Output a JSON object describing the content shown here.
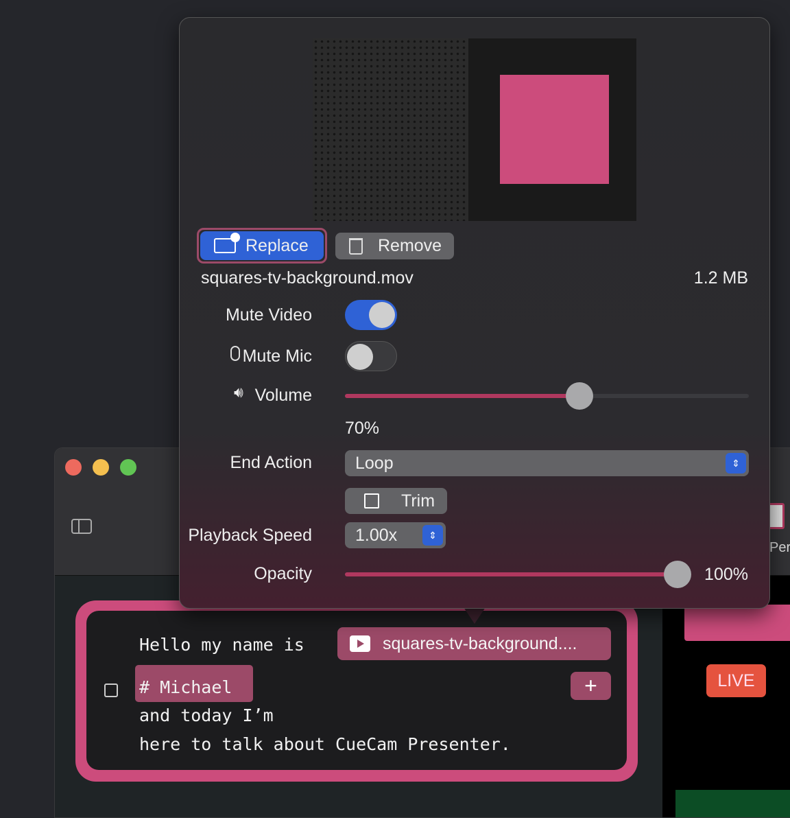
{
  "media": {
    "replace_label": "Replace",
    "remove_label": "Remove",
    "filename": "squares-tv-background.mov",
    "filesize": "1.2 MB"
  },
  "settings": {
    "mute_video_label": "Mute Video",
    "mute_video_on": true,
    "mute_mic_label": "Mute Mic",
    "mute_mic_on": false,
    "volume_label": "Volume",
    "volume_value": "70%",
    "volume_fraction": 0.58,
    "end_action_label": "End Action",
    "end_action_value": "Loop",
    "trim_label": "Trim",
    "playback_speed_label": "Playback Speed",
    "playback_speed_value": "1.00x",
    "opacity_label": "Opacity",
    "opacity_value": "100%",
    "opacity_fraction": 1.0
  },
  "script": {
    "line1": "Hello my name is",
    "media_chip": "squares-tv-background....",
    "heading": "# Michael",
    "line3": "and today I’m",
    "line4": "here to talk about CueCam Presenter.",
    "add_label": "+"
  },
  "preview": {
    "live_badge": "LIVE",
    "toolbar_partial_label": "Per"
  },
  "colors": {
    "accent_pink": "#cc4c7c",
    "accent_blue": "#2f62d6",
    "live_red": "#e5533f"
  }
}
